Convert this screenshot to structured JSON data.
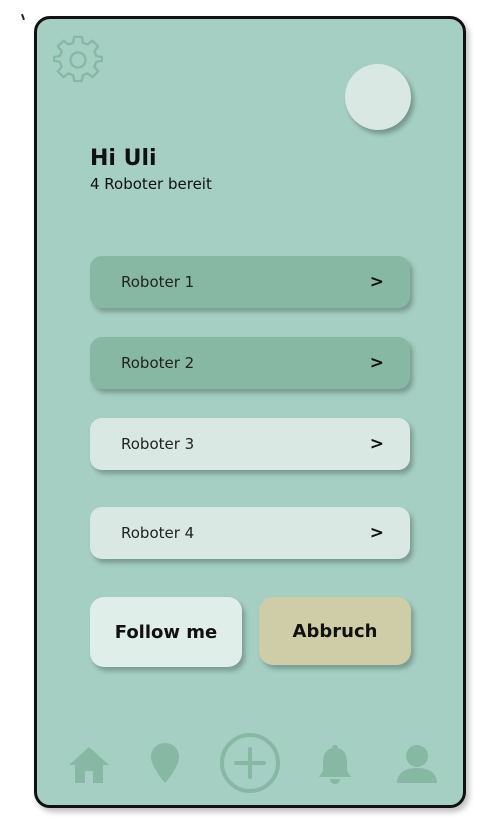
{
  "header": {
    "greeting": "Hi Uli",
    "subtitle": "4 Roboter bereit"
  },
  "icons": {
    "settings": "gear-icon",
    "avatar": "avatar-circle"
  },
  "robots": [
    {
      "label": "Roboter 1",
      "chevron": ">",
      "state": "active"
    },
    {
      "label": "Roboter 2",
      "chevron": ">",
      "state": "active"
    },
    {
      "label": "Roboter 3",
      "chevron": ">",
      "state": "inactive"
    },
    {
      "label": "Roboter 4",
      "chevron": ">",
      "state": "inactive"
    }
  ],
  "actions": {
    "follow_label": "Follow me",
    "cancel_label": "Abbruch"
  },
  "nav": [
    "home-icon",
    "location-pin-icon",
    "add-icon",
    "bell-icon",
    "user-icon"
  ],
  "colors": {
    "background": "#a4cfc2",
    "robot_active": "#87b8a4",
    "robot_inactive": "#d9e8e3",
    "cancel_button": "#cfcca8",
    "nav_icons": "#87b8a4"
  }
}
